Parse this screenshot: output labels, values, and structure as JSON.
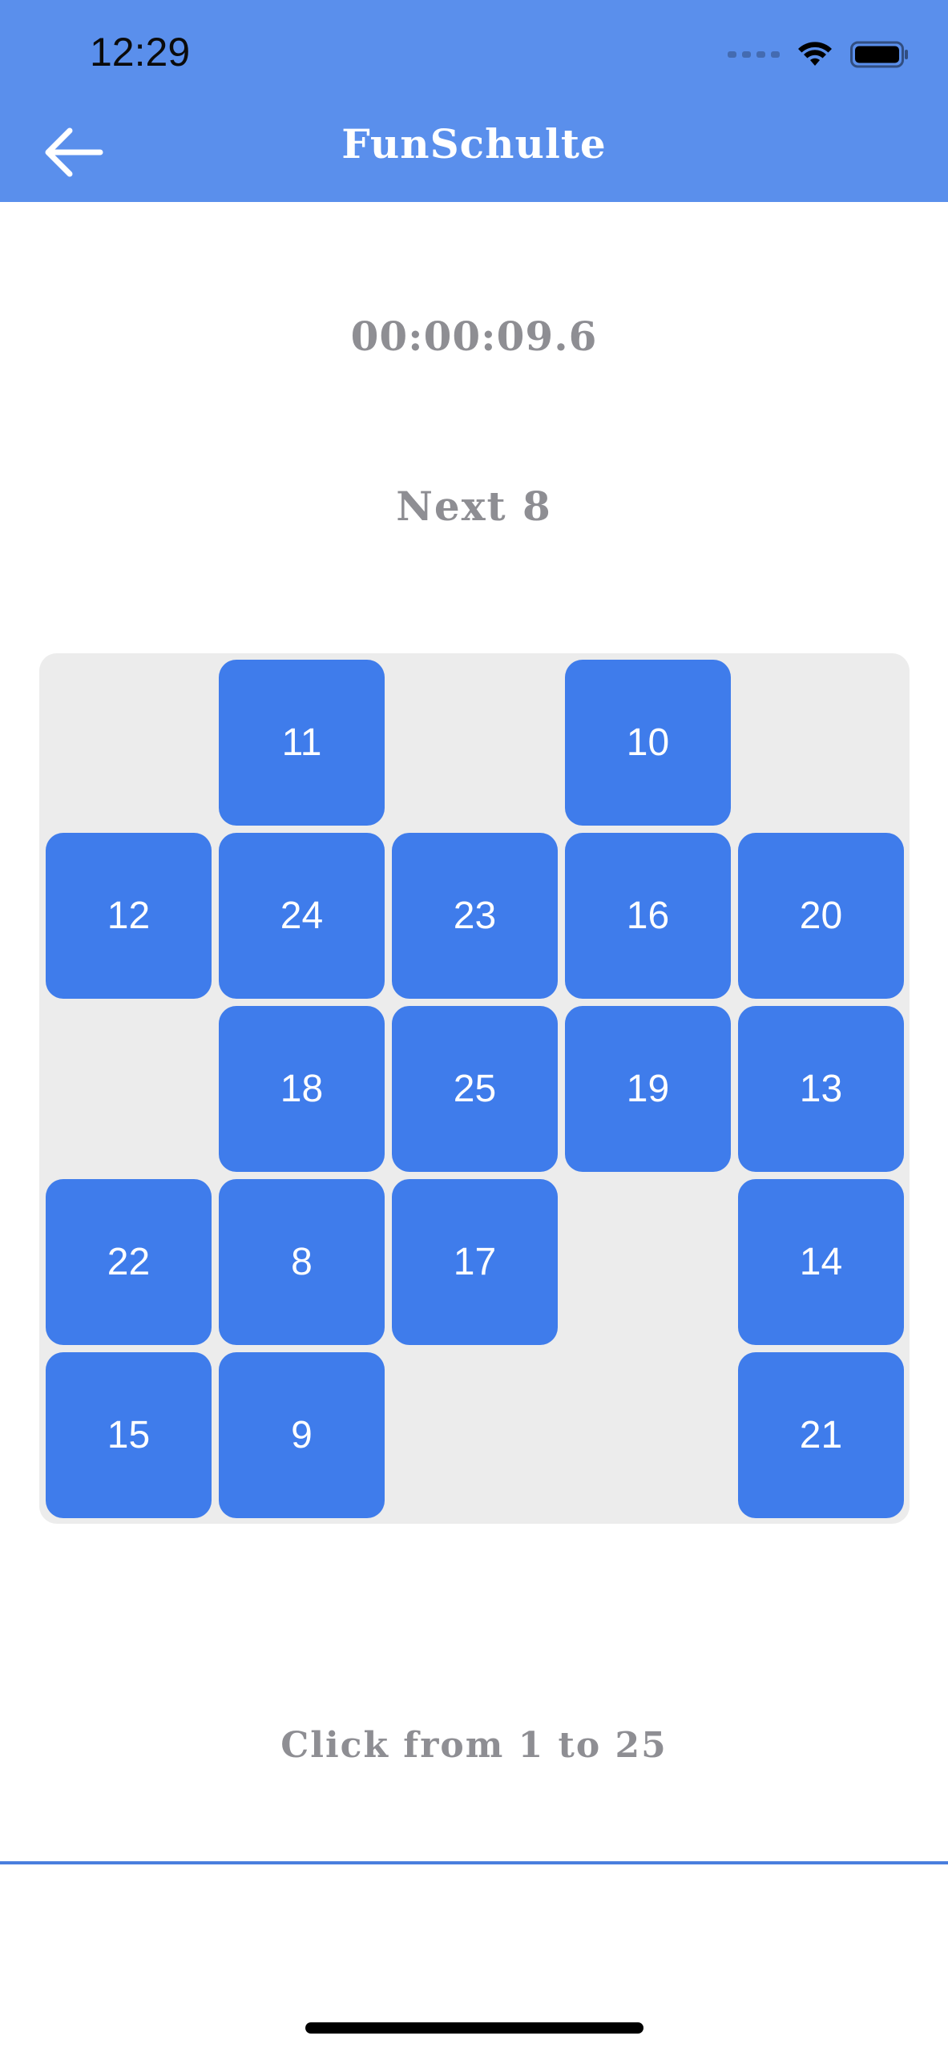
{
  "status_bar": {
    "time": "12:29"
  },
  "header": {
    "title": "FunSchulte",
    "back_icon": "arrow-left-icon"
  },
  "game": {
    "timer": "00:00:09.6",
    "next_label": "Next 8",
    "board": [
      [
        "",
        "11",
        "",
        "10",
        ""
      ],
      [
        "12",
        "24",
        "23",
        "16",
        "20"
      ],
      [
        "",
        "18",
        "25",
        "19",
        "13"
      ],
      [
        "22",
        "8",
        "17",
        "",
        "14"
      ],
      [
        "15",
        "9",
        "",
        "",
        "21"
      ]
    ]
  },
  "footer": {
    "hint": "Click from 1 to 25"
  },
  "colors": {
    "header_bg": "#5A8FEC",
    "tile": "#3F7CEB",
    "board_bg": "#ECECEC",
    "muted_text": "#8E8E93"
  }
}
